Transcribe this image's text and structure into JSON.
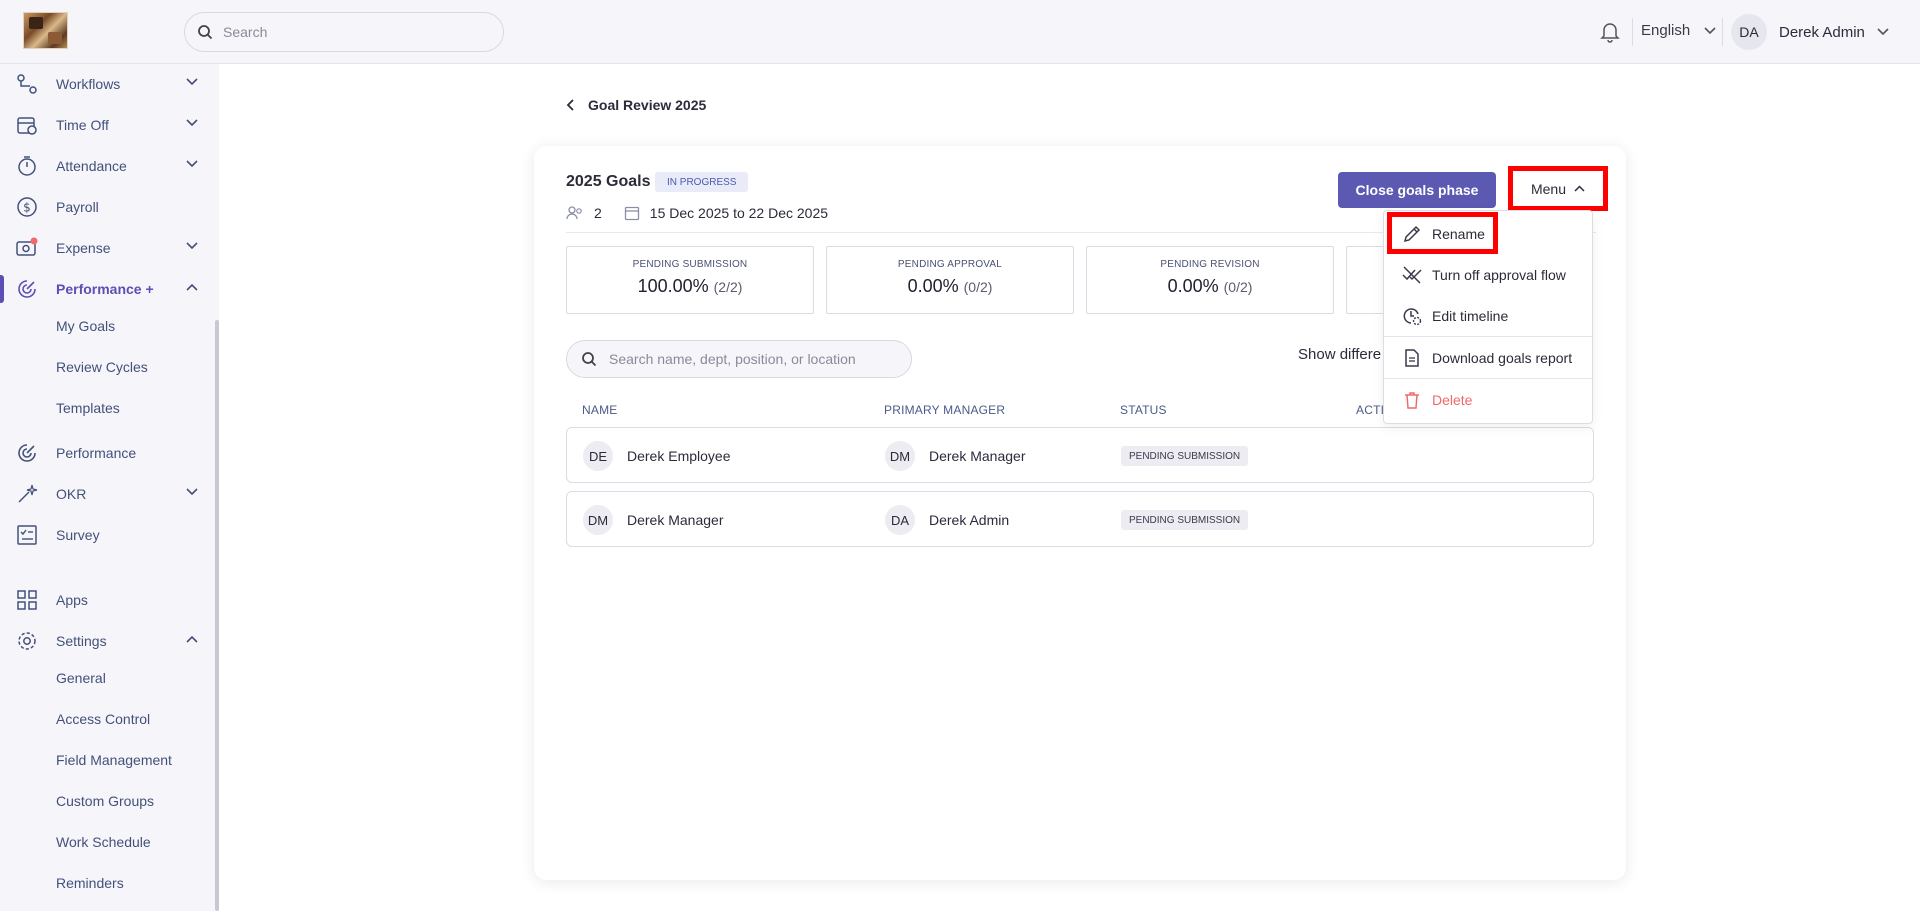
{
  "header": {
    "search_placeholder": "Search",
    "language": "English",
    "user_initials": "DA",
    "user_name": "Derek Admin"
  },
  "sidebar": {
    "items": [
      {
        "label": "Workflows",
        "icon": "workflow-icon"
      },
      {
        "label": "Time Off",
        "icon": "calendar-clock-icon"
      },
      {
        "label": "Attendance",
        "icon": "stopwatch-icon"
      },
      {
        "label": "Payroll",
        "icon": "dollar-circle-icon"
      },
      {
        "label": "Expense",
        "icon": "expense-icon"
      },
      {
        "label": "Performance +",
        "icon": "performance-icon"
      },
      {
        "label": "Performance",
        "icon": "performance-icon"
      },
      {
        "label": "OKR",
        "icon": "sparkle-icon"
      },
      {
        "label": "Survey",
        "icon": "survey-icon"
      },
      {
        "label": "Apps",
        "icon": "apps-grid-icon"
      },
      {
        "label": "Settings",
        "icon": "gear-icon"
      }
    ],
    "performance_sub": [
      "My Goals",
      "Review Cycles",
      "Templates"
    ],
    "settings_sub": [
      "General",
      "Access Control",
      "Field Management",
      "Custom Groups",
      "Work Schedule",
      "Reminders"
    ]
  },
  "page": {
    "back_label": "Goal Review 2025",
    "card_title": "2025 Goals",
    "status_badge": "IN PROGRESS",
    "participants": "2",
    "date_range": "15 Dec 2025 to 22 Dec 2025",
    "close_button": "Close goals phase",
    "menu_button": "Menu"
  },
  "stats": [
    {
      "label": "PENDING SUBMISSION",
      "value": "100.00%",
      "fraction": "(2/2)"
    },
    {
      "label": "PENDING APPROVAL",
      "value": "0.00%",
      "fraction": "(0/2)"
    },
    {
      "label": "PENDING REVISION",
      "value": "0.00%",
      "fraction": "(0/2)"
    }
  ],
  "table": {
    "search_placeholder": "Search name, dept, position, or location",
    "show_diff_label": "Show differe",
    "headers": {
      "name": "NAME",
      "manager": "PRIMARY MANAGER",
      "status": "STATUS",
      "actions": "ACTI"
    },
    "rows": [
      {
        "initials": "DE",
        "name": "Derek Employee",
        "mgr_initials": "DM",
        "manager": "Derek Manager",
        "status": "PENDING SUBMISSION"
      },
      {
        "initials": "DM",
        "name": "Derek Manager",
        "mgr_initials": "DA",
        "manager": "Derek Admin",
        "status": "PENDING SUBMISSION"
      }
    ]
  },
  "menu": {
    "items": [
      {
        "label": "Rename",
        "icon": "pencil-icon"
      },
      {
        "label": "Turn off approval flow",
        "icon": "approval-off-icon"
      },
      {
        "label": "Edit timeline",
        "icon": "clock-gear-icon"
      },
      {
        "label": "Download goals report",
        "icon": "document-icon"
      },
      {
        "label": "Delete",
        "icon": "trash-icon"
      }
    ]
  },
  "colors": {
    "accent": "#5c59b2",
    "danger": "#f06a6a",
    "highlight": "#ff0000"
  }
}
